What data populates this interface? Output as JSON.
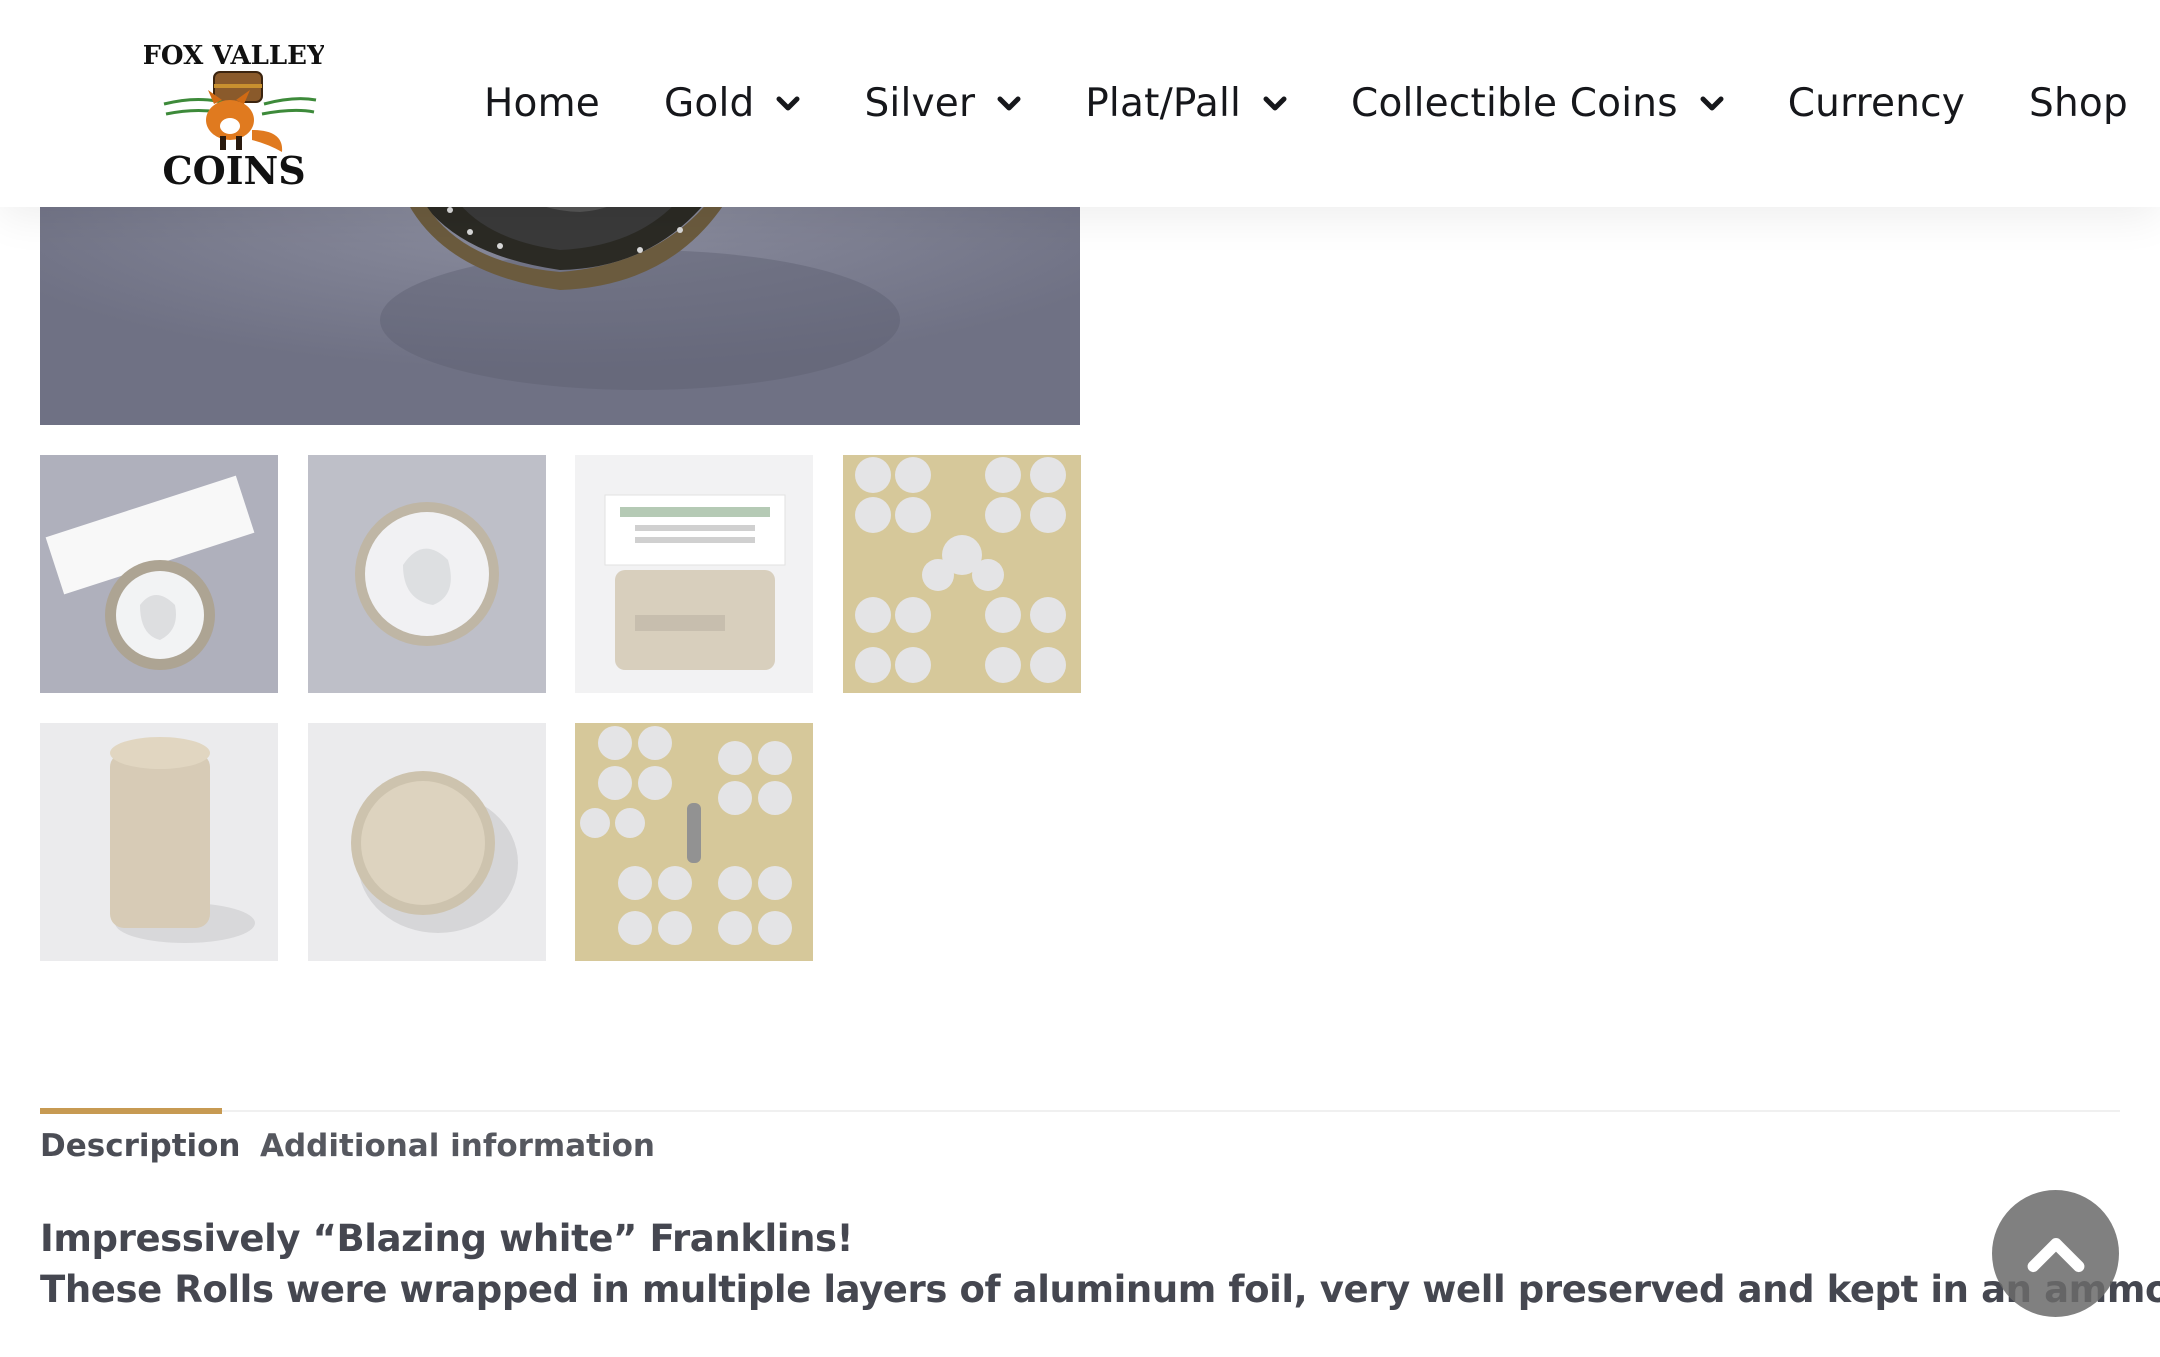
{
  "brand": {
    "logo_top_text": "FOX VALLEY",
    "logo_bottom_text": "COINS"
  },
  "nav": {
    "home": "Home",
    "gold": "Gold",
    "silver": "Silver",
    "platpall": "Plat/Pall",
    "collectible": "Collectible Coins",
    "currency": "Currency",
    "shop": "Shop"
  },
  "gallery": {
    "thumb_count": 7
  },
  "tabs": {
    "description": "Description",
    "additional": "Additional information"
  },
  "description": {
    "line1": "Impressively “Blazing white” Franklins!",
    "line2": "These Rolls were wrapped in multiple layers of aluminum foil, very well preserved and kept in an ammo can."
  },
  "colors": {
    "accent": "#c79a52",
    "nav_text": "#16171b",
    "body_text": "#454750"
  }
}
